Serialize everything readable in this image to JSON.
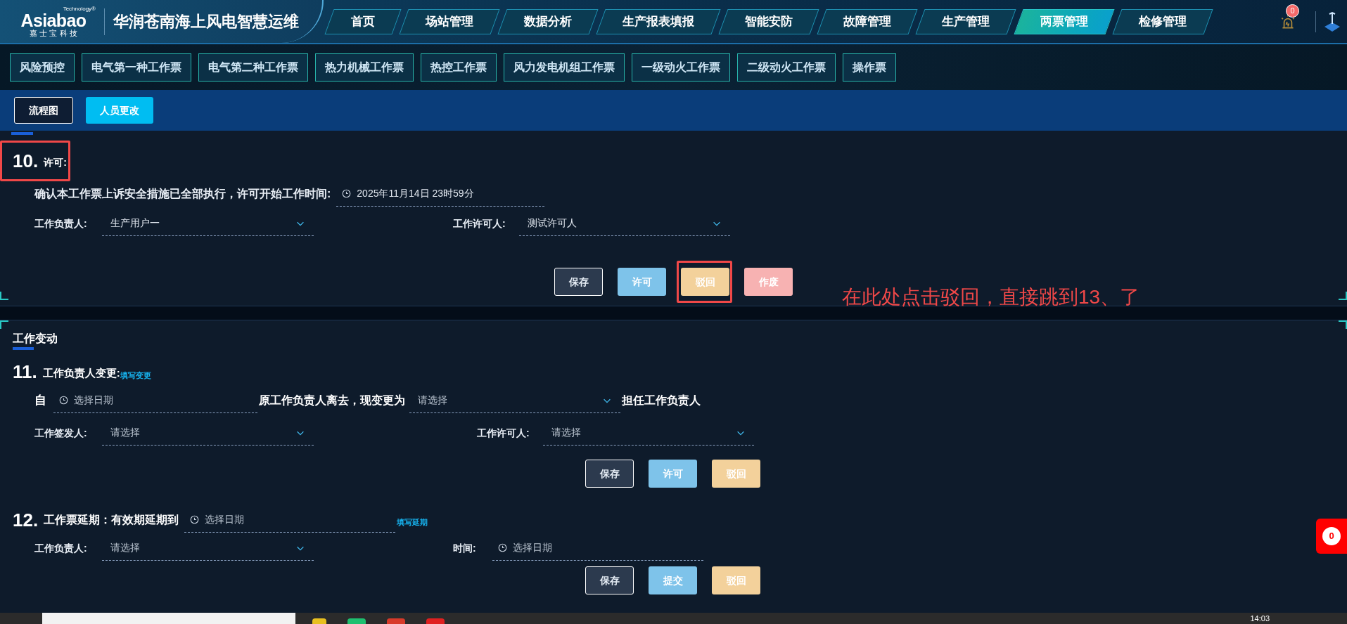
{
  "header": {
    "logo_top": "Technology®",
    "logo": "Asiabao",
    "logo_sub": "嘉 士 宝 科 技",
    "title": "华润苍南海上风电智慧运维"
  },
  "nav": [
    {
      "label": "首页",
      "selected": false
    },
    {
      "label": "场站管理",
      "selected": false
    },
    {
      "label": "数据分析",
      "selected": false
    },
    {
      "label": "生产报表填报",
      "selected": false
    },
    {
      "label": "智能安防",
      "selected": false
    },
    {
      "label": "故障管理",
      "selected": false
    },
    {
      "label": "生产管理",
      "selected": false
    },
    {
      "label": "两票管理",
      "selected": true
    },
    {
      "label": "检修管理",
      "selected": false
    }
  ],
  "alarm": {
    "count": "0"
  },
  "subnav": [
    "风险预控",
    "电气第一种工作票",
    "电气第二种工作票",
    "热力机械工作票",
    "热控工作票",
    "风力发电机组工作票",
    "一级动火工作票",
    "二级动火工作票",
    "操作票"
  ],
  "tabs": [
    {
      "label": "流程图",
      "selected": false
    },
    {
      "label": "人员更改",
      "selected": true
    }
  ],
  "permit": {
    "number": "10.",
    "title": "许可:",
    "statement": "确认本工作票上诉安全措施已全部执行，许可开始工作时间:",
    "time": "2025年11月14日 23时59分",
    "fields": [
      {
        "label": "工作负责人:",
        "value": "生产用户一",
        "kind": "select"
      },
      {
        "label": "工作许可人:",
        "value": "测试许可人",
        "kind": "select"
      }
    ],
    "buttons": [
      {
        "label": "保存",
        "kind": "save"
      },
      {
        "label": "许可",
        "kind": "permit"
      },
      {
        "label": "驳回",
        "kind": "reject"
      },
      {
        "label": "作废",
        "kind": "void"
      }
    ]
  },
  "annotation": {
    "text": "在此处点击驳回，直接跳到13、了"
  },
  "change": {
    "heading": "工作变动",
    "item11": {
      "number": "11.",
      "title": "工作负责人变更:",
      "link": "填写变更",
      "from": "自",
      "date_placeholder": "选择日期",
      "middle": "原工作负责人离去，现变更为",
      "select_placeholder": "请选择",
      "suffix": "担任工作负责人",
      "fields": [
        {
          "label": "工作签发人:",
          "placeholder": "请选择",
          "kind": "select"
        },
        {
          "label": "工作许可人:",
          "placeholder": "请选择",
          "kind": "select"
        }
      ],
      "buttons": [
        {
          "label": "保存",
          "kind": "save"
        },
        {
          "label": "许可",
          "kind": "permit"
        },
        {
          "label": "驳回",
          "kind": "reject"
        }
      ]
    },
    "item12": {
      "number": "12.",
      "title": "工作票延期：有效期延期到",
      "date_placeholder": "选择日期",
      "link": "填写延期",
      "fields": [
        {
          "label": "工作负责人:",
          "placeholder": "请选择",
          "kind": "select"
        },
        {
          "label": "时间:",
          "placeholder": "选择日期",
          "kind": "date"
        }
      ],
      "buttons": [
        {
          "label": "保存",
          "kind": "save"
        },
        {
          "label": "提交",
          "kind": "permit"
        },
        {
          "label": "驳回",
          "kind": "reject"
        }
      ]
    }
  },
  "float_badge": "0",
  "taskbar": {
    "clock": "14:03"
  }
}
